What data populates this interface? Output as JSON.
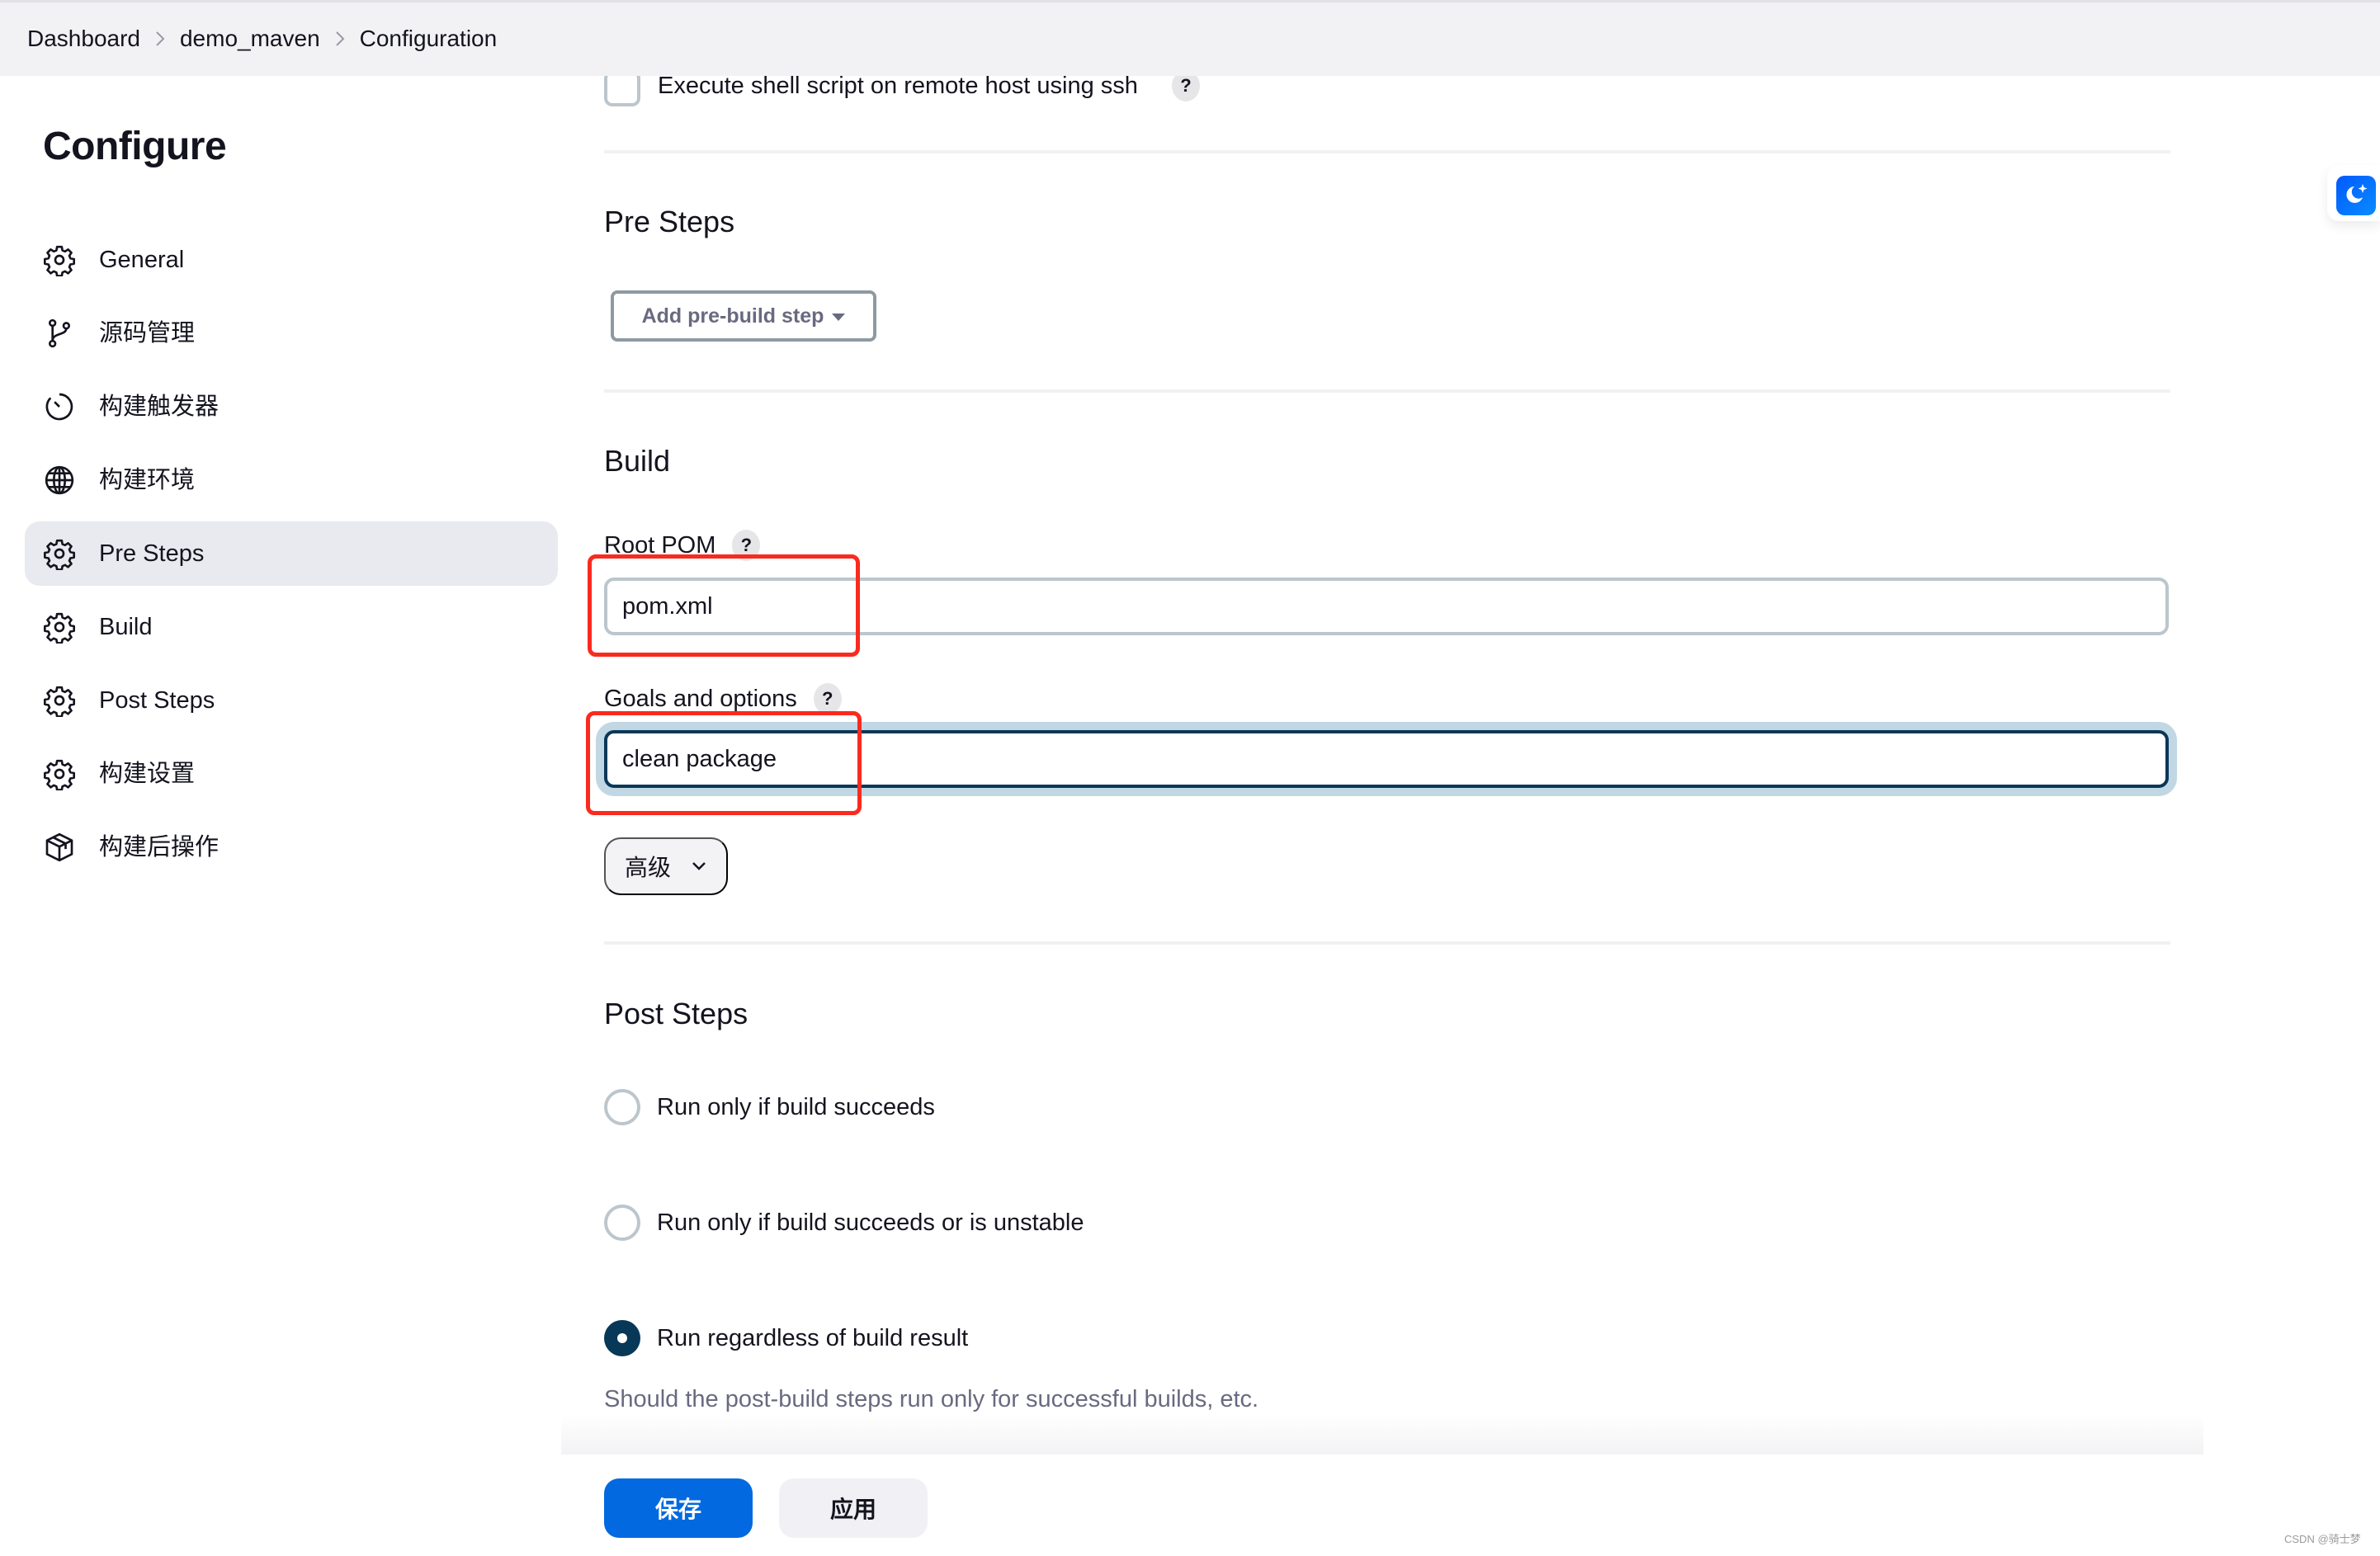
{
  "breadcrumb": {
    "items": [
      "Dashboard",
      "demo_maven",
      "Configuration"
    ]
  },
  "sidebar": {
    "title": "Configure",
    "items": [
      {
        "label": "General",
        "icon": "gear-icon",
        "active": false
      },
      {
        "label": "源码管理",
        "icon": "git-branch-icon",
        "active": false
      },
      {
        "label": "构建触发器",
        "icon": "timer-icon",
        "active": false
      },
      {
        "label": "构建环境",
        "icon": "globe-icon",
        "active": false
      },
      {
        "label": "Pre Steps",
        "icon": "gear-icon",
        "active": true
      },
      {
        "label": "Build",
        "icon": "gear-icon",
        "active": false
      },
      {
        "label": "Post Steps",
        "icon": "gear-icon",
        "active": false
      },
      {
        "label": "构建设置",
        "icon": "gear-icon",
        "active": false
      },
      {
        "label": "构建后操作",
        "icon": "package-icon",
        "active": false
      }
    ]
  },
  "main": {
    "ssh_checkbox": {
      "label": "Execute shell script on remote host using ssh",
      "checked": false,
      "help": "?"
    },
    "pre_steps": {
      "title": "Pre Steps",
      "add_button": "Add pre-build step"
    },
    "build": {
      "title": "Build",
      "root_pom": {
        "label": "Root POM",
        "help": "?",
        "value": "pom.xml"
      },
      "goals": {
        "label": "Goals and options",
        "help": "?",
        "value": "clean package"
      },
      "advanced_button": "高级"
    },
    "post_steps": {
      "title": "Post Steps",
      "options": [
        {
          "label": "Run only if build succeeds",
          "checked": false
        },
        {
          "label": "Run only if build succeeds or is unstable",
          "checked": false
        },
        {
          "label": "Run regardless of build result",
          "checked": true
        }
      ],
      "hint": "Should the post-build steps run only for successful builds, etc."
    }
  },
  "footer": {
    "save_label": "保存",
    "apply_label": "应用"
  },
  "watermark": "CSDN @骑士梦",
  "colors": {
    "primary": "#0369e1",
    "focus_border": "#083857",
    "focus_ring": "#c1d7e4",
    "annotation": "#fa2a1f",
    "active_nav": "#e9eaef"
  }
}
